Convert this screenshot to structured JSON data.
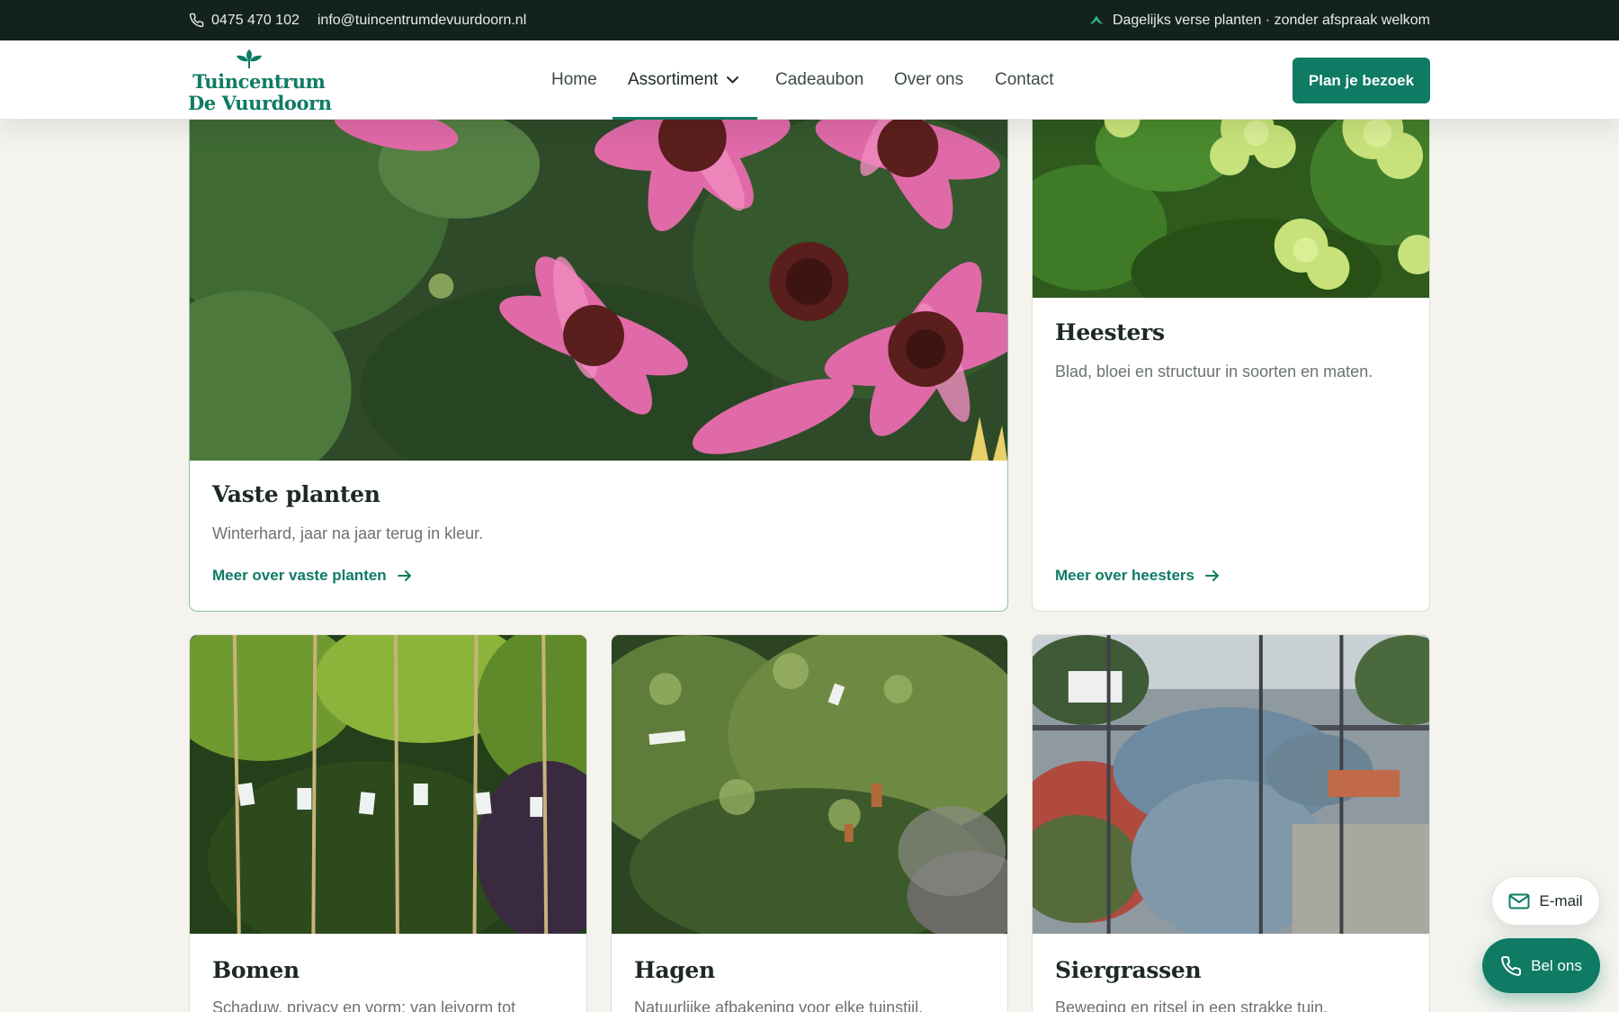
{
  "topbar": {
    "phone": "0475 470 102",
    "email": "info@tuincentrumdevuurdoorn.nl",
    "notice": "Dagelijks verse planten · zonder afspraak welkom"
  },
  "brand": {
    "line1": "Tuincentrum",
    "line2": "De Vuurdoorn",
    "color": "#0f7b64"
  },
  "nav": {
    "items": [
      {
        "label": "Home"
      },
      {
        "label": "Assortiment",
        "active": true,
        "has_dropdown": true
      },
      {
        "label": "Cadeaubon"
      },
      {
        "label": "Over ons"
      },
      {
        "label": "Contact"
      }
    ],
    "cta": "Plan je bezoek"
  },
  "categories": [
    {
      "title": "Vaste planten",
      "description": "Winterhard, jaar na jaar terug in kleur.",
      "link": "Meer over vaste planten"
    },
    {
      "title": "Heesters",
      "description": "Blad, bloei en structuur in soorten en maten.",
      "link": "Meer over heesters"
    },
    {
      "title": "Bomen",
      "description": "Schaduw, privacy en vorm: van leivorm tot"
    },
    {
      "title": "Hagen",
      "description": "Natuurlijke afbakening voor elke tuinstijl."
    },
    {
      "title": "Siergrassen",
      "description": "Beweging en ritsel in een strakke tuin."
    }
  ],
  "floating": {
    "email": "E-mail",
    "call": "Bel ons"
  },
  "icons": {
    "phone": "phone-icon",
    "mail": "mail-icon",
    "leaf": "leaf-icon",
    "arrow": "arrow-right-icon",
    "chevron": "chevron-down-icon"
  },
  "colors": {
    "accent": "#0f7b64",
    "topbar": "#14221d",
    "background": "#f4f3ee"
  }
}
